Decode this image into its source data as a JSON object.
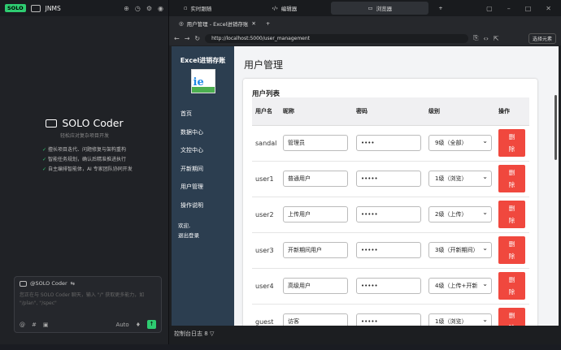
{
  "left_panel": {
    "badge": "SOLO",
    "project": "JNMS"
  },
  "hero": {
    "title": "SOLO Coder",
    "subtitle": "轻松应对复杂项目开发",
    "features": [
      "擅长项目迭代、问题修复与架构重构",
      "智能任务规划，确认后精准推进执行",
      "自主编排智能体，AI 专家团队协同开发"
    ]
  },
  "chat": {
    "agent": "@SOLO Coder",
    "placeholder": "您正在与 SOLO Coder 聊天，输入 \"/\" 获取更多能力，如 \"/plan\", \"/spec\"",
    "mode": "Auto"
  },
  "window_tabs": [
    "实时跟随",
    "编辑器",
    "浏览器"
  ],
  "browser": {
    "tab_title": "用户管理 - Excel进销存账",
    "url": "http://localhost:5000/user_management",
    "picker": "选择元素"
  },
  "app": {
    "system_title": "Excel进销存账",
    "nav": [
      "首页",
      "数据中心",
      "文控中心",
      "开新期间",
      "用户管理",
      "操作说明"
    ],
    "welcome": "欢迎,",
    "logout": "退出登录",
    "page_title": "用户管理",
    "list_title": "用户列表",
    "headers": [
      "用户名",
      "昵称",
      "密码",
      "级别",
      "操作"
    ],
    "rows": [
      {
        "username": "sandal",
        "nickname": "管理员",
        "password": "••••",
        "level": "9级（全部）",
        "action": "删除"
      },
      {
        "username": "user1",
        "nickname": "普通用户",
        "password": "•••••",
        "level": "1级（浏览）",
        "action": "删除"
      },
      {
        "username": "user2",
        "nickname": "上传用户",
        "password": "•••••",
        "level": "2级（上传）",
        "action": "删除"
      },
      {
        "username": "user3",
        "nickname": "开新期间用户",
        "password": "•••••",
        "level": "3级（开新期间）",
        "action": "删除"
      },
      {
        "username": "user4",
        "nickname": "高级用户",
        "password": "•••••",
        "level": "4级（上传+开新",
        "action": "删除"
      },
      {
        "username": "guest",
        "nickname": "访客",
        "password": "•••••",
        "level": "1级（浏览）",
        "action": "删除"
      }
    ]
  },
  "console": {
    "label": "控制台日志",
    "count": "8"
  },
  "colors": {
    "accent": "#2ecc71",
    "sidebar": "#2c3e50",
    "danger": "#f0483e"
  }
}
